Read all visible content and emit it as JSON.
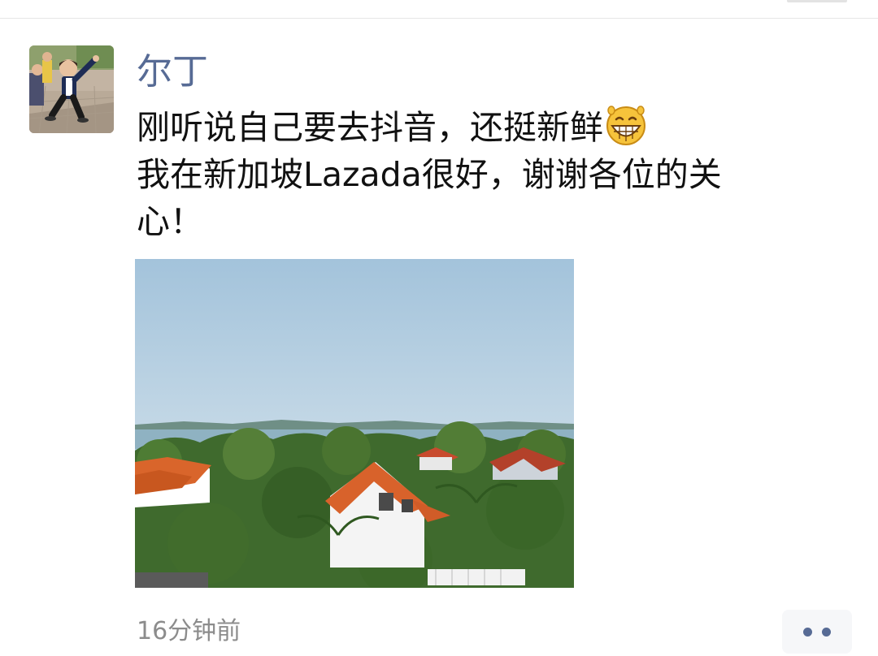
{
  "post": {
    "author": "尔丁",
    "text_lines": [
      "刚听说自己要去抖音，还挺新鲜",
      "我在新加坡Lazada很好，谢谢各位的关",
      "心！"
    ],
    "emoji": "grinning-face-emoji",
    "avatar_icon": "avatar-child-photo",
    "photo_icon": "landscape-photo",
    "timestamp": "16分钟前"
  },
  "colors": {
    "author_name": "#576b95",
    "body_text": "#111111",
    "timestamp": "#8c8c8c",
    "more_button_bg": "#f6f7f9",
    "more_dots": "#576b95"
  }
}
